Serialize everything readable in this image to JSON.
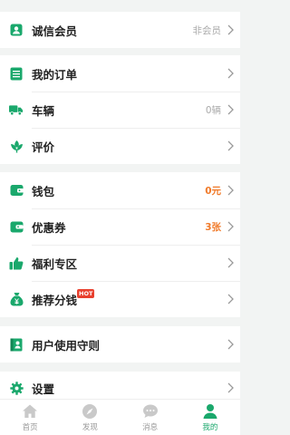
{
  "colors": {
    "accent": "#1aa86c",
    "orange": "#f07a2a",
    "hot": "#e8402e"
  },
  "sections": [
    {
      "rows": [
        {
          "label": "诚信会员",
          "value": "非会员",
          "value_style": "gray",
          "icon": "member-card-icon"
        }
      ]
    },
    {
      "rows": [
        {
          "label": "我的订单",
          "value": "",
          "value_style": "gray",
          "icon": "order-list-icon"
        },
        {
          "label": "车辆",
          "value": "0辆",
          "value_style": "gray",
          "icon": "truck-icon"
        },
        {
          "label": "评价",
          "value": "",
          "value_style": "gray",
          "icon": "review-flower-icon"
        }
      ]
    },
    {
      "rows": [
        {
          "label": "钱包",
          "value": "0元",
          "value_style": "orange",
          "icon": "wallet-icon"
        },
        {
          "label": "优惠券",
          "value": "3张",
          "value_style": "orange",
          "icon": "coupon-icon"
        },
        {
          "label": "福利专区",
          "value": "",
          "value_style": "gray",
          "icon": "thumbs-up-icon"
        },
        {
          "label": "推荐分钱",
          "value": "",
          "value_style": "gray",
          "icon": "money-bag-icon",
          "badge": "HOT"
        }
      ]
    },
    {
      "rows": [
        {
          "label": "用户使用守则",
          "value": "",
          "value_style": "gray",
          "icon": "guide-book-icon"
        }
      ]
    },
    {
      "rows": [
        {
          "label": "设置",
          "value": "",
          "value_style": "gray",
          "icon": "gear-icon"
        }
      ]
    }
  ],
  "tabbar": [
    {
      "label": "首页",
      "icon": "home-icon",
      "active": false
    },
    {
      "label": "发现",
      "icon": "compass-icon",
      "active": false
    },
    {
      "label": "消息",
      "icon": "chat-bubble-icon",
      "active": false
    },
    {
      "label": "我的",
      "icon": "person-icon",
      "active": true
    }
  ]
}
